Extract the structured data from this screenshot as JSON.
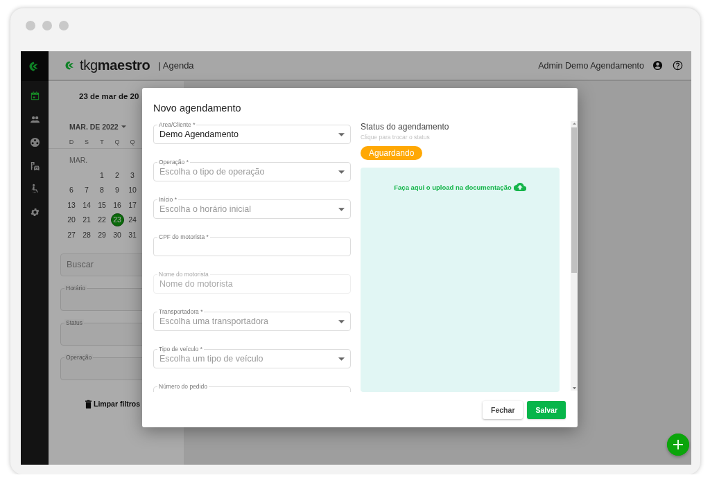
{
  "app_header": {
    "logo": "tkg**maestro**",
    "section": "| Agenda",
    "user": "Admin Demo Agendamento"
  },
  "sidebar": {
    "items": [
      {
        "kind": "calendar",
        "selected": true
      },
      {
        "kind": "people",
        "selected": false
      },
      {
        "kind": "reel",
        "selected": false
      },
      {
        "kind": "fleet",
        "selected": false
      },
      {
        "kind": "accessible",
        "selected": false
      },
      {
        "kind": "settings",
        "selected": false
      }
    ]
  },
  "agenda": {
    "date_title": "23 de mar de 20",
    "month_picker": "MAR. DE 2022",
    "weekdays": [
      "D",
      "S",
      "T",
      "Q",
      "Q"
    ],
    "month_label": "MAR.",
    "weeks": [
      [
        {
          "day": "1",
          "selected": false
        },
        {
          "day": "2",
          "selected": false
        },
        {
          "day": "3",
          "selected": false
        }
      ],
      [
        {
          "day": "6",
          "selected": false
        },
        {
          "day": "7",
          "selected": false
        },
        {
          "day": "8",
          "selected": false
        },
        {
          "day": "9",
          "selected": false
        },
        {
          "day": "10",
          "selected": false
        }
      ],
      [
        {
          "day": "13",
          "selected": false
        },
        {
          "day": "14",
          "selected": false
        },
        {
          "day": "15",
          "selected": false
        },
        {
          "day": "16",
          "selected": false
        },
        {
          "day": "17",
          "selected": false
        }
      ],
      [
        {
          "day": "20",
          "selected": false
        },
        {
          "day": "21",
          "selected": false
        },
        {
          "day": "22",
          "selected": false
        },
        {
          "day": "23",
          "selected": true
        },
        {
          "day": "24",
          "selected": false
        }
      ],
      [
        {
          "day": "27",
          "selected": false
        },
        {
          "day": "28",
          "selected": false
        },
        {
          "day": "29",
          "selected": false
        },
        {
          "day": "30",
          "selected": false
        },
        {
          "day": "31",
          "selected": false
        }
      ]
    ]
  },
  "filters": {
    "search": {
      "placeholder": "Buscar"
    },
    "fields": [
      {
        "label": "Horário"
      },
      {
        "label": "Status"
      },
      {
        "label": "Operação"
      }
    ],
    "clear_button": "Limpar filtros"
  },
  "dialog": {
    "title": "Novo agendamento",
    "fields": [
      {
        "kind": "select",
        "label": "Area/Cliente *",
        "value": "Demo Agendamento",
        "disabled": false
      },
      {
        "kind": "select",
        "label": "Operação *",
        "placeholder": "Escolha o tipo de operação",
        "disabled": false
      },
      {
        "kind": "select",
        "label": "Início *",
        "placeholder": "Escolha o horário inicial",
        "disabled": false
      },
      {
        "kind": "text",
        "label": "CPF do motorista *",
        "disabled": false
      },
      {
        "kind": "text",
        "label": "Nome do motorista",
        "placeholder": "Nome do motorista",
        "disabled": true
      },
      {
        "kind": "select",
        "label": "Transportadora *",
        "placeholder": "Escolha uma transportadora",
        "disabled": false
      },
      {
        "kind": "select",
        "label": "Tipo de veículo *",
        "placeholder": "Escolha um tipo de veículo",
        "disabled": false
      },
      {
        "kind": "text",
        "label": "Número do pedido",
        "disabled": false
      }
    ],
    "status": {
      "title": "Status do agendamento",
      "hint": "Clique para trocar o status",
      "badge": "Aguardando"
    },
    "upload": {
      "text": "Faça aqui o upload na documentação"
    },
    "buttons": [
      {
        "label": "Fechar",
        "kind": "secondary"
      },
      {
        "label": "Salvar",
        "kind": "primary"
      }
    ]
  }
}
